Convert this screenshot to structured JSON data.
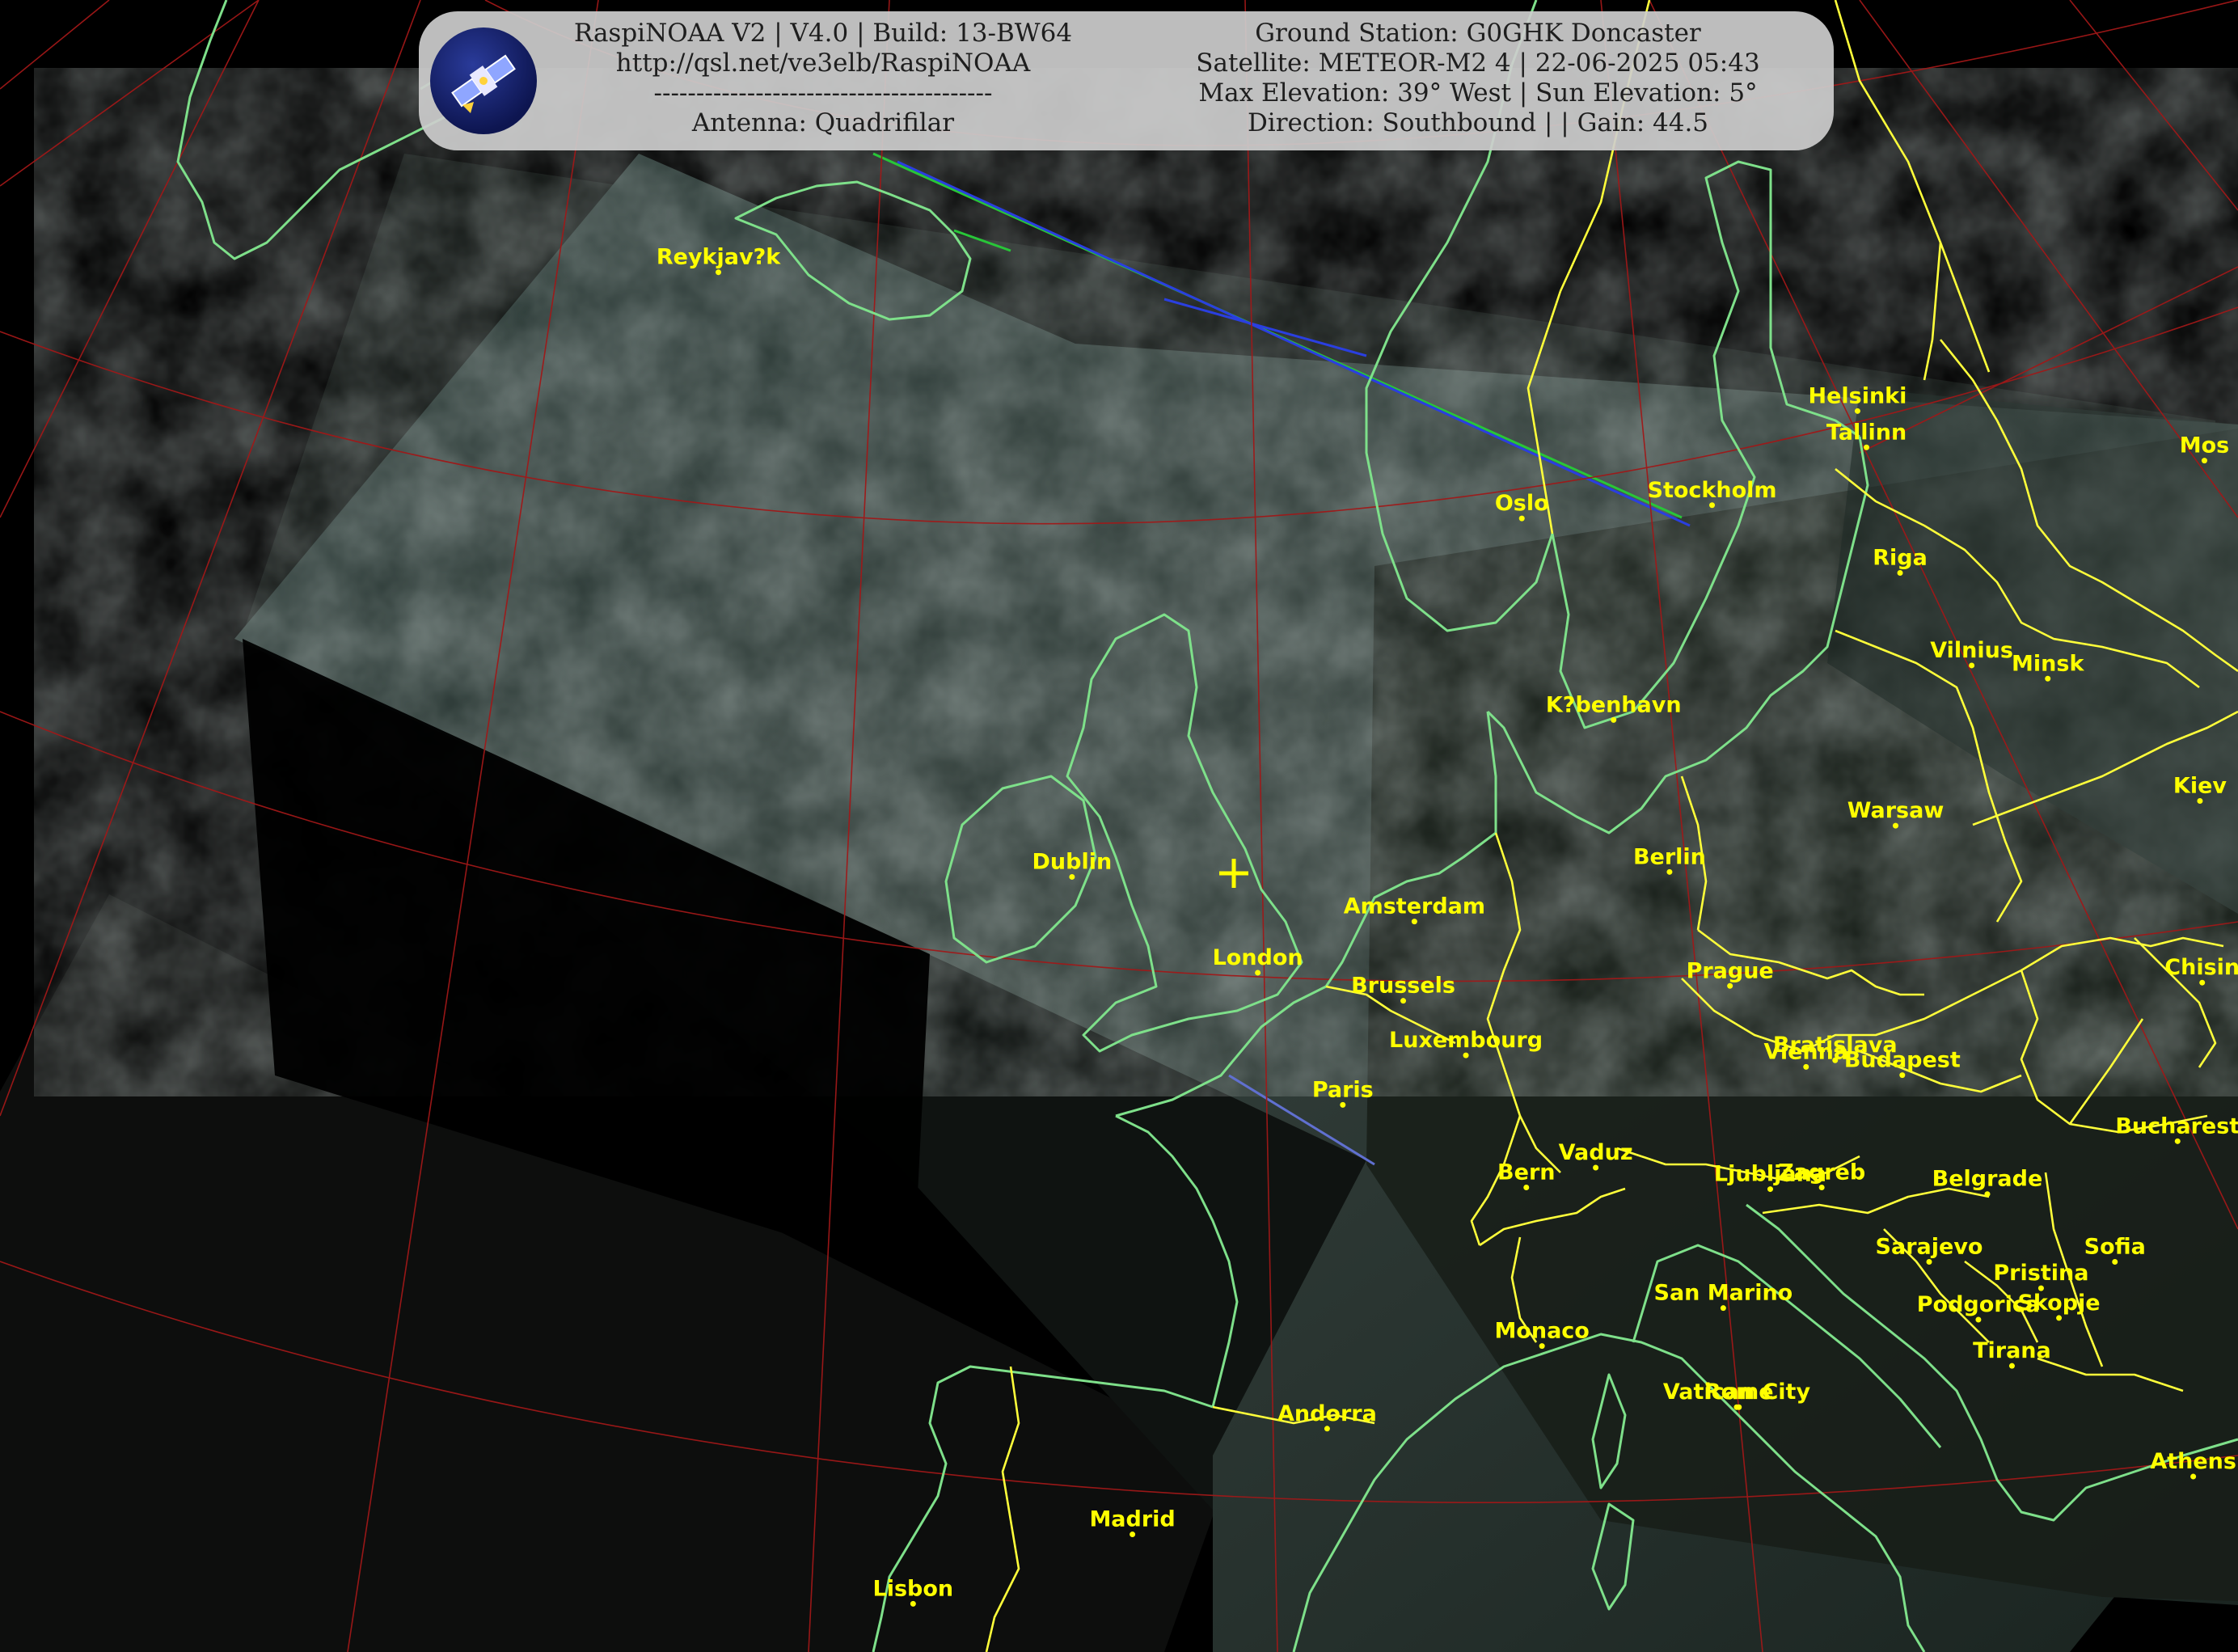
{
  "banner": {
    "left_lines": [
      "RaspiNOAA V2 | V4.0 | Build: 13-BW64",
      "http://qsl.net/ve3elb/RaspiNOAA",
      "----------------------------------------",
      "Antenna: Quadrifilar"
    ],
    "right_lines": [
      "Ground Station: G0GHK Doncaster",
      "Satellite: METEOR-M2 4 | 22-06-2025 05:43",
      "Max Elevation: 39° West | Sun Elevation: 5°",
      "Direction: Southbound | | Gain: 44.5"
    ]
  },
  "colors": {
    "coastline": "#7ee08a",
    "borders": "#ffff3a",
    "graticule": "#a01818",
    "city_labels": "#ffff00",
    "background": "#000000"
  },
  "ground_station_marker": "plus-marker",
  "cities": [
    {
      "name": "Reykjav?k",
      "lx": 0.321,
      "ly": 0.156
    },
    {
      "name": "Helsinki",
      "lx": 0.83,
      "ly": 0.24
    },
    {
      "name": "Tallinn",
      "lx": 0.834,
      "ly": 0.262
    },
    {
      "name": "Mos",
      "lx": 0.985,
      "ly": 0.27
    },
    {
      "name": "Oslo",
      "lx": 0.68,
      "ly": 0.305
    },
    {
      "name": "Stockholm",
      "lx": 0.765,
      "ly": 0.297
    },
    {
      "name": "Riga",
      "lx": 0.849,
      "ly": 0.338
    },
    {
      "name": "Vilnius",
      "lx": 0.881,
      "ly": 0.394
    },
    {
      "name": "Minsk",
      "lx": 0.915,
      "ly": 0.402
    },
    {
      "name": "K?benhavn",
      "lx": 0.721,
      "ly": 0.427
    },
    {
      "name": "Kiev",
      "lx": 0.983,
      "ly": 0.476
    },
    {
      "name": "Warsaw",
      "lx": 0.847,
      "ly": 0.491
    },
    {
      "name": "Dublin",
      "lx": 0.479,
      "ly": 0.522
    },
    {
      "name": "Berlin",
      "lx": 0.746,
      "ly": 0.519
    },
    {
      "name": "Amsterdam",
      "lx": 0.632,
      "ly": 0.549
    },
    {
      "name": "London",
      "lx": 0.562,
      "ly": 0.58
    },
    {
      "name": "Prague",
      "lx": 0.773,
      "ly": 0.588
    },
    {
      "name": "Chisin",
      "lx": 0.984,
      "ly": 0.586
    },
    {
      "name": "Brussels",
      "lx": 0.627,
      "ly": 0.597
    },
    {
      "name": "Luxembourg",
      "lx": 0.655,
      "ly": 0.63
    },
    {
      "name": "Vienna",
      "lx": 0.807,
      "ly": 0.637
    },
    {
      "name": "Bratislava",
      "lx": 0.82,
      "ly": 0.633
    },
    {
      "name": "Budapest",
      "lx": 0.85,
      "ly": 0.642
    },
    {
      "name": "Paris",
      "lx": 0.6,
      "ly": 0.66
    },
    {
      "name": "Bucharest",
      "lx": 0.973,
      "ly": 0.682
    },
    {
      "name": "Vaduz",
      "lx": 0.713,
      "ly": 0.698
    },
    {
      "name": "Bern",
      "lx": 0.682,
      "ly": 0.71
    },
    {
      "name": "Ljubljana",
      "lx": 0.791,
      "ly": 0.711
    },
    {
      "name": "Zagreb",
      "lx": 0.814,
      "ly": 0.71
    },
    {
      "name": "Belgrade",
      "lx": 0.888,
      "ly": 0.714
    },
    {
      "name": "Sarajevo",
      "lx": 0.862,
      "ly": 0.755
    },
    {
      "name": "Sofia",
      "lx": 0.945,
      "ly": 0.755
    },
    {
      "name": "Pristina",
      "lx": 0.912,
      "ly": 0.771
    },
    {
      "name": "San Marino",
      "lx": 0.77,
      "ly": 0.783
    },
    {
      "name": "Podgorica",
      "lx": 0.884,
      "ly": 0.79
    },
    {
      "name": "Skopje",
      "lx": 0.92,
      "ly": 0.789
    },
    {
      "name": "Monaco",
      "lx": 0.689,
      "ly": 0.806
    },
    {
      "name": "Tirana",
      "lx": 0.899,
      "ly": 0.818
    },
    {
      "name": "Vatican City",
      "lx": 0.776,
      "ly": 0.843
    },
    {
      "name": "Rome",
      "lx": 0.777,
      "ly": 0.843
    },
    {
      "name": "Andorra",
      "lx": 0.593,
      "ly": 0.856
    },
    {
      "name": "Athens",
      "lx": 0.98,
      "ly": 0.885
    },
    {
      "name": "Madrid",
      "lx": 0.506,
      "ly": 0.92
    },
    {
      "name": "Lisbon",
      "lx": 0.408,
      "ly": 0.962
    }
  ]
}
